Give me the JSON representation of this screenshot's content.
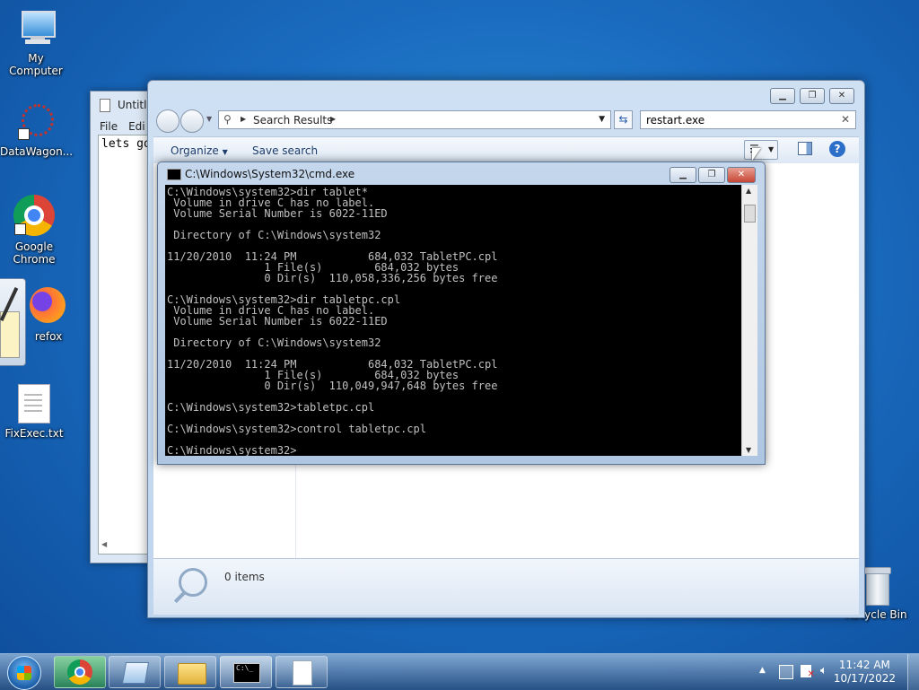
{
  "desktop": {
    "icons": [
      {
        "label": "My Computer"
      },
      {
        "label": "DataWagon..."
      },
      {
        "label": "Google Chrome"
      },
      {
        "label": "refox"
      },
      {
        "label": "FixExec.txt"
      },
      {
        "label": "Recycle Bin"
      }
    ]
  },
  "notepad": {
    "title": "Untitle",
    "menu": [
      "File",
      "Edi"
    ],
    "text": "lets go"
  },
  "explorer": {
    "address": "Search Results",
    "search_value": "restart.exe",
    "toolbar": {
      "organize": "Organize",
      "save_search": "Save search"
    },
    "status_text": "0 items"
  },
  "cmd": {
    "title": "C:\\Windows\\System32\\cmd.exe",
    "lines": [
      "C:\\Windows\\system32>dir tablet*",
      " Volume in drive C has no label.",
      " Volume Serial Number is 6022-11ED",
      "",
      " Directory of C:\\Windows\\system32",
      "",
      "11/20/2010  11:24 PM           684,032 TabletPC.cpl",
      "               1 File(s)        684,032 bytes",
      "               0 Dir(s)  110,058,336,256 bytes free",
      "",
      "C:\\Windows\\system32>dir tabletpc.cpl",
      " Volume in drive C has no label.",
      " Volume Serial Number is 6022-11ED",
      "",
      " Directory of C:\\Windows\\system32",
      "",
      "11/20/2010  11:24 PM           684,032 TabletPC.cpl",
      "               1 File(s)        684,032 bytes",
      "               0 Dir(s)  110,049,947,648 bytes free",
      "",
      "C:\\Windows\\system32>tabletpc.cpl",
      "",
      "C:\\Windows\\system32>control tabletpc.cpl",
      "",
      "C:\\Windows\\system32>_"
    ]
  },
  "taskbar": {
    "time": "11:42 AM",
    "date": "10/17/2022"
  },
  "colors": {
    "desktop": "#1a6cc0",
    "close_button": "#c74634",
    "cmd_text": "#c0c0c0"
  }
}
